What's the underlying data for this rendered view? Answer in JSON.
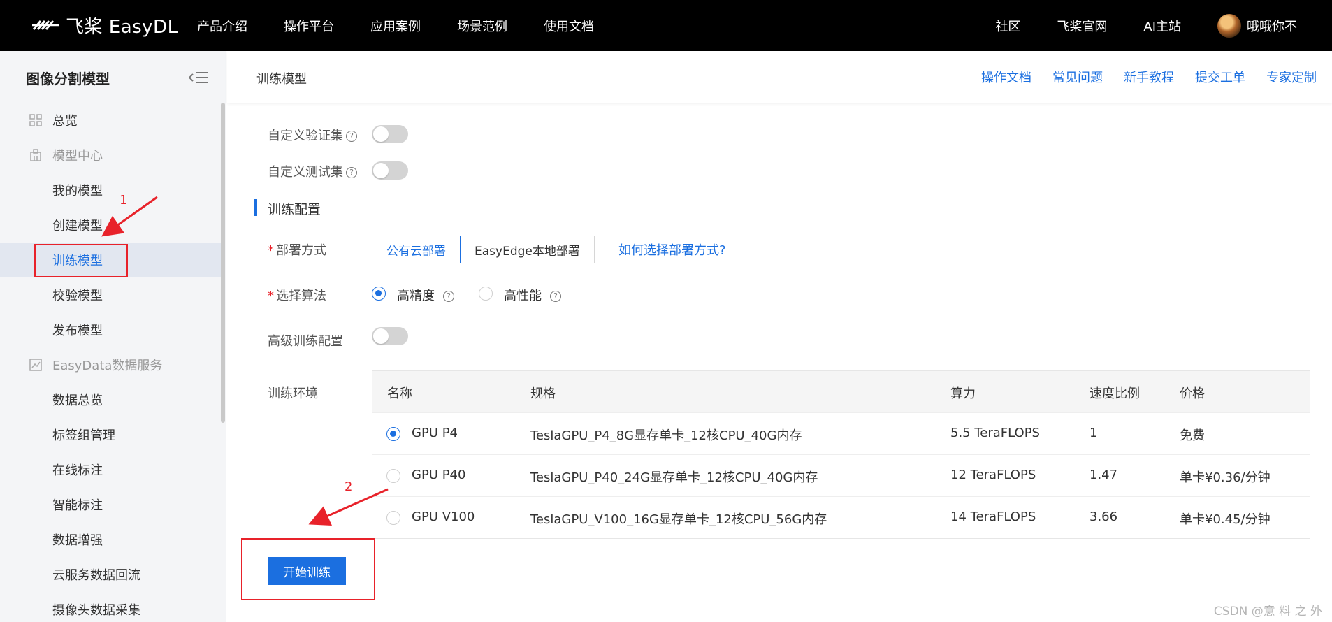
{
  "topnav": {
    "brand": "飞桨 EasyDL",
    "links": [
      "产品介绍",
      "操作平台",
      "应用案例",
      "场景范例",
      "使用文档"
    ],
    "right_links": [
      "社区",
      "飞桨官网",
      "AI主站"
    ],
    "user_name": "哦哦你不"
  },
  "sidebar": {
    "title": "图像分割模型",
    "items": [
      {
        "label": "总览",
        "icon": "grid-icon"
      },
      {
        "label": "模型中心",
        "icon": "building-icon"
      },
      {
        "label": "我的模型"
      },
      {
        "label": "创建模型"
      },
      {
        "label": "训练模型"
      },
      {
        "label": "校验模型"
      },
      {
        "label": "发布模型"
      },
      {
        "label": "EasyData数据服务",
        "icon": "chart-icon"
      },
      {
        "label": "数据总览"
      },
      {
        "label": "标签组管理"
      },
      {
        "label": "在线标注"
      },
      {
        "label": "智能标注"
      },
      {
        "label": "数据增强"
      },
      {
        "label": "云服务数据回流"
      },
      {
        "label": "摄像头数据采集"
      }
    ]
  },
  "header": {
    "page_title": "训练模型",
    "help_links": [
      "操作文档",
      "常见问题",
      "新手教程",
      "提交工单",
      "专家定制"
    ]
  },
  "form": {
    "custom_val_label": "自定义验证集",
    "custom_test_label": "自定义测试集",
    "section_title": "训练配置",
    "deploy_label": "部署方式",
    "deploy_options": [
      "公有云部署",
      "EasyEdge本地部署"
    ],
    "deploy_help_link": "如何选择部署方式?",
    "algo_label": "选择算法",
    "algo_options": [
      "高精度",
      "高性能"
    ],
    "advanced_label": "高级训练配置",
    "env_label": "训练环境",
    "required_mark": "*",
    "help_mark": "?"
  },
  "env_table": {
    "columns": [
      "名称",
      "规格",
      "算力",
      "速度比例",
      "价格"
    ],
    "rows": [
      [
        "GPU P4",
        "TeslaGPU_P4_8G显存单卡_12核CPU_40G内存",
        "5.5 TeraFLOPS",
        "1",
        "免费"
      ],
      [
        "GPU P40",
        "TeslaGPU_P40_24G显存单卡_12核CPU_40G内存",
        "12 TeraFLOPS",
        "1.47",
        "单卡¥0.36/分钟"
      ],
      [
        "GPU V100",
        "TeslaGPU_V100_16G显存单卡_12核CPU_56G内存",
        "14 TeraFLOPS",
        "3.66",
        "单卡¥0.45/分钟"
      ]
    ],
    "selected_row": 0
  },
  "start_button": "开始训练",
  "annotations": {
    "step1": "1",
    "step2": "2",
    "color": "#e8222a"
  },
  "watermark": "CSDN @意 料 之 外",
  "colors": {
    "accent": "#1b6fe0",
    "nav_bg": "#000000",
    "sidebar_bg": "#f4f5f7"
  }
}
